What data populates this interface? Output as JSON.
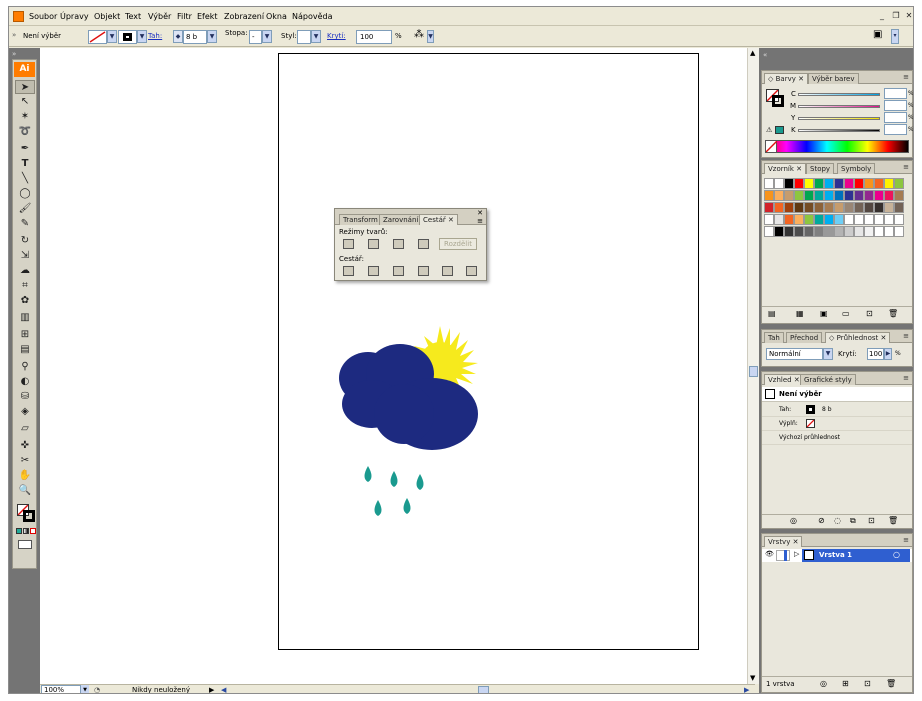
{
  "menubar": {
    "items": [
      "Soubor",
      "Úpravy",
      "Objekt",
      "Text",
      "Výběr",
      "Filtr",
      "Efekt",
      "Zobrazení",
      "Okna",
      "Nápověda"
    ]
  },
  "controlbar": {
    "selection_label": "Není výběr",
    "stroke_label": "Tah:",
    "stroke_value": "8 b",
    "brush_label": "Stopa:",
    "brush_value": "-",
    "style_label": "Styl:",
    "opacity_label": "Krytí:",
    "opacity_value": "100",
    "opacity_unit": "%"
  },
  "toolbox": {
    "logo": "Ai",
    "tools": [
      "selection-tool",
      "direct-selection-tool",
      "magic-wand-tool",
      "lasso-tool",
      "pen-tool",
      "type-tool",
      "line-tool",
      "ellipse-tool",
      "paintbrush-tool",
      "pencil-tool",
      "rotate-tool",
      "scale-tool",
      "warp-tool",
      "free-transform-tool",
      "symbol-sprayer-tool",
      "graph-tool",
      "mesh-tool",
      "gradient-tool",
      "eyedropper-tool",
      "blend-tool",
      "live-paint-bucket-tool",
      "live-paint-selection-tool",
      "eraser-tool",
      "slice-tool",
      "scissors-tool",
      "hand-tool",
      "zoom-tool"
    ]
  },
  "pathfinder": {
    "tabs": [
      "Transform",
      "Zarovnání",
      "Cestář"
    ],
    "shape_modes_label": "Režimy tvarů:",
    "expand_button": "Rozdělit",
    "pathfinders_label": "Cestář:"
  },
  "color_panel": {
    "tabs": [
      "Barvy",
      "Výběr barev"
    ],
    "channels": [
      "C",
      "M",
      "Y",
      "K"
    ],
    "unit": "%"
  },
  "swatches_panel": {
    "tabs": [
      "Vzorník",
      "Stopy",
      "Symboly"
    ]
  },
  "transparency_panel": {
    "tabs": [
      "Tah",
      "Přechod",
      "Průhlednost"
    ],
    "blend_mode": "Normální",
    "opacity_label": "Krytí:",
    "opacity_value": "100",
    "unit": "%"
  },
  "appearance_panel": {
    "tabs": [
      "Vzhled",
      "Grafické styly"
    ],
    "title": "Není výběr",
    "stroke_label": "Tah:",
    "stroke_value": "8 b",
    "fill_label": "Výplň:",
    "default_transparency": "Výchozí průhlednost"
  },
  "layers_panel": {
    "tabs": [
      "Vrstvy"
    ],
    "layer_name": "Vrstva 1",
    "footer": "1 vrstva"
  },
  "statusbar": {
    "zoom": "100%",
    "status_text": "Nikdy neuložený"
  },
  "colors": {
    "cloud": "#1d2a80",
    "sun": "#f6ea1d",
    "rain": "#1a9a8f",
    "accent": "#ff7c00",
    "layer_highlight": "#2f5fd0"
  }
}
